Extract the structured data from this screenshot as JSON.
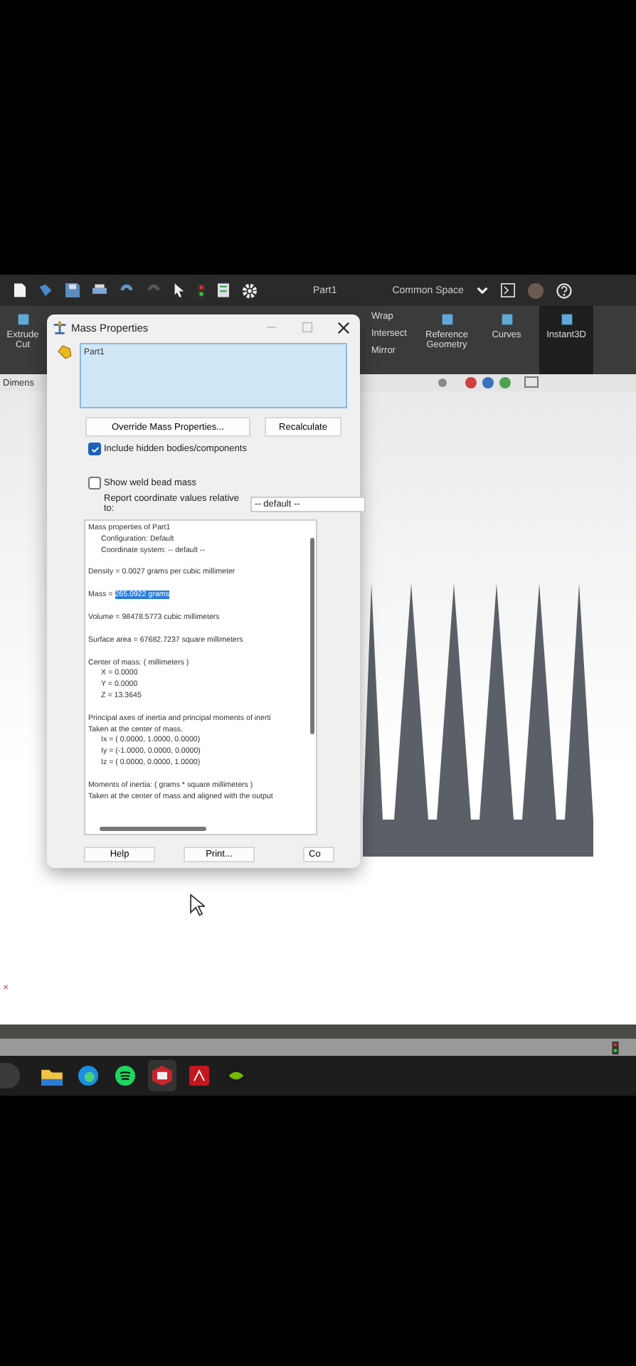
{
  "toolbar": {
    "document_title": "Part1",
    "workspace": "Common Space"
  },
  "ribbon": {
    "items": [
      {
        "label": "Extrude Cut",
        "kind": "big",
        "selected": false
      },
      {
        "label": "Wrap",
        "kind": "small",
        "selected": false
      },
      {
        "label": "Intersect",
        "kind": "small",
        "selected": false
      },
      {
        "label": "Mirror",
        "kind": "small",
        "selected": false
      },
      {
        "label": "Reference Geometry",
        "kind": "big",
        "selected": false
      },
      {
        "label": "Curves",
        "kind": "big",
        "selected": false
      },
      {
        "label": "Instant3D",
        "kind": "big",
        "selected": true
      }
    ]
  },
  "tab_strip": {
    "label": "Dimens"
  },
  "origin_marker": "×",
  "dialog": {
    "title": "Mass Properties",
    "selection": "Part1",
    "buttons": [
      "Override Mass Properties...",
      "Recalculate"
    ],
    "options": [
      {
        "label": "Include hidden bodies/components",
        "checked": true
      },
      {
        "label": "Show weld bead mass",
        "checked": false
      }
    ],
    "coordinate_label": "Report coordinate values relative to:",
    "coordinate_value": "-- default --",
    "report": [
      {
        "lines": [
          {
            "text": "Mass properties of Part1"
          }
        ],
        "children": [
          "Configuration: Default",
          "Coordinate system: -- default --"
        ]
      },
      {
        "lines": [
          {
            "text": "Density = 0.0027 grams per cubic millimeter"
          }
        ]
      },
      {
        "lines": [
          {
            "text": "Mass = ",
            "highlighted": "265.0922 grams"
          }
        ]
      },
      {
        "lines": [
          {
            "text": "Volume = 98478.5773 cubic millimeters"
          }
        ]
      },
      {
        "lines": [
          {
            "text": "Surface area = 67682.7237  square millimeters"
          }
        ]
      },
      {
        "lines": [
          {
            "text": "Center of mass: ( millimeters )"
          }
        ],
        "children": [
          "X = 0.0000",
          "Y = 0.0000",
          "Z = 13.3645"
        ]
      },
      {
        "lines": [
          {
            "text": "Principal axes of inertia and principal moments of inerti"
          },
          {
            "text": "Taken at the center of mass."
          }
        ],
        "children": [
          "Ix = ( 0.0000,  1.0000,  0.0000)",
          "Iy = (-1.0000,  0.0000,  0.0000)",
          "Iz = ( 0.0000,  0.0000,  1.0000)"
        ]
      },
      {
        "lines": [
          {
            "text": "Moments of inertia: ( grams *  square millimeters )"
          },
          {
            "text": "Taken at the center of mass and aligned with the output"
          }
        ]
      }
    ],
    "footer_buttons": [
      "Help",
      "Print...",
      "Co"
    ]
  },
  "taskbar": {
    "apps": [
      {
        "kind": "folder",
        "selected": false
      },
      {
        "kind": "browser",
        "selected": false
      },
      {
        "kind": "music",
        "selected": false
      },
      {
        "kind": "cad",
        "selected": true
      },
      {
        "kind": "pdf",
        "selected": false
      },
      {
        "kind": "gpu",
        "selected": false
      }
    ]
  }
}
